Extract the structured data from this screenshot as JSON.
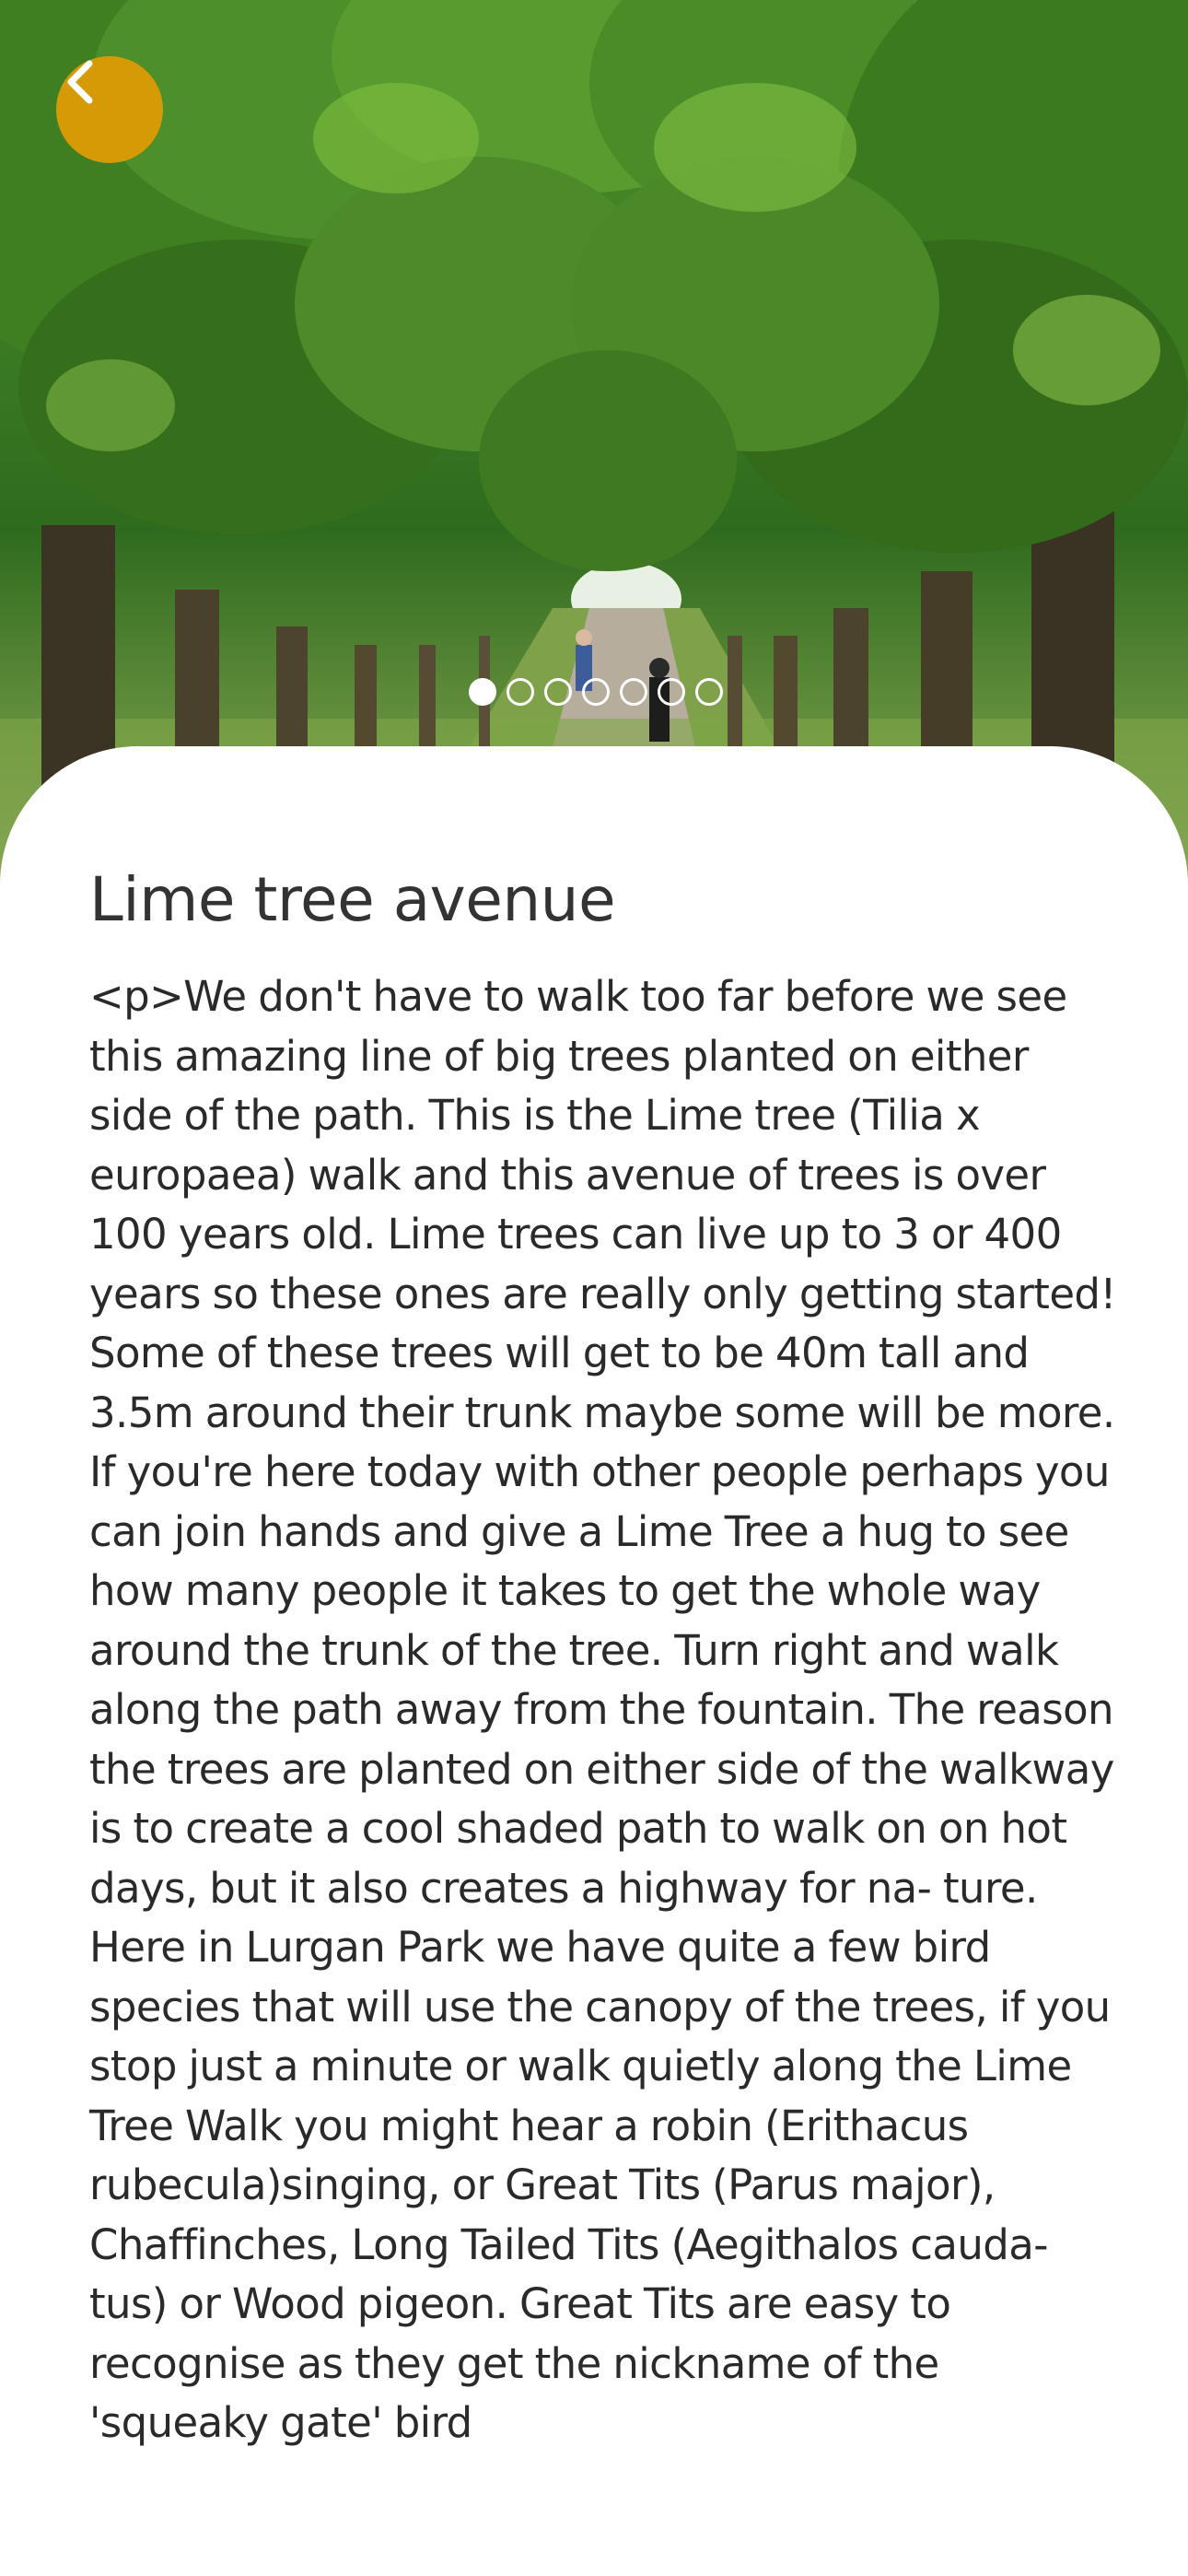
{
  "header": {
    "back_icon": "chevron-left-icon",
    "accent_color": "#d69a06"
  },
  "carousel": {
    "total_images": 7,
    "active_index": 0
  },
  "content": {
    "title": "Lime tree avenue",
    "body": "<p>We don't have to walk too far before we see this amazing line of big trees planted on either side of the path. This is the Lime tree (Tilia x europaea) walk and this avenue of trees is over 100 years old. Lime trees can live up to 3 or 400 years so these ones are really only getting started! Some of these trees will get to be 40m tall and 3.5m around their trunk maybe some will be more. If you're here today with other people perhaps you can join hands and give a Lime Tree a hug to see how many people it takes to get the whole way around the trunk of the tree. Turn right and walk along the path away from the fountain. The reason the trees are planted on either side of the walkway is to create a cool shaded path to walk on on hot days, but it also creates a highway for na- ture. Here in Lurgan Park we have quite a few bird species that will use the canopy of the trees, if you stop just a minute or walk quietly along the Lime Tree Walk you might hear a robin (Erithacus rubecula)singing, or Great Tits (Parus major), Chaffinches, Long Tailed Tits (Aegithalos cauda- tus) or Wood pigeon. Great Tits are easy to recognise as they get the nickname of the 'squeaky gate' bird"
  }
}
